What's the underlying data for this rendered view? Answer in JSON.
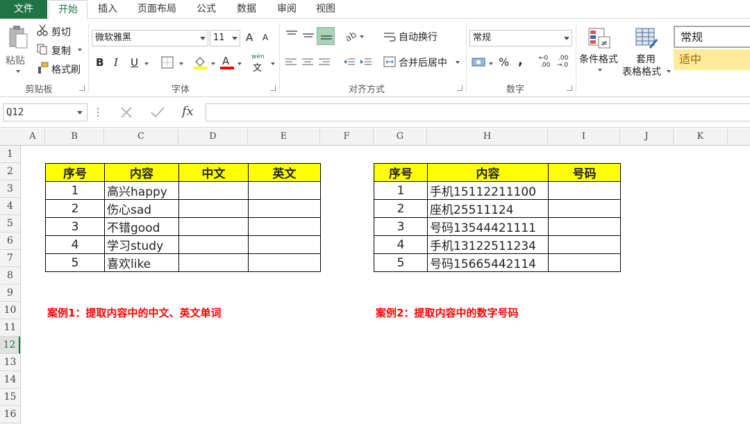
{
  "tabs": [
    "文件",
    "开始",
    "插入",
    "页面布局",
    "公式",
    "数据",
    "审阅",
    "视图"
  ],
  "clipboard": {
    "paste": "粘贴",
    "cut": "剪切",
    "copy": "复制",
    "format_painter": "格式刷",
    "title": "剪贴板"
  },
  "font": {
    "name": "微软雅黑",
    "size": "11",
    "bold": "B",
    "italic": "I",
    "underline": "U",
    "increase": "A",
    "decrease": "A",
    "wen_top": "wén",
    "wen_bottom": "文",
    "title": "字体"
  },
  "alignment": {
    "wrap": "自动换行",
    "merge": "合并后居中",
    "title": "对齐方式"
  },
  "number": {
    "format": "常规",
    "percent": "%",
    "comma": ",",
    "inc_top": "←0",
    "inc_bottom": ".00",
    "dec_top": ".00",
    "dec_bottom": "→.0",
    "title": "数字"
  },
  "styles": {
    "conditional": "条件格式",
    "table_top": "套用",
    "table_bottom": "表格格式",
    "normal": "常规",
    "neutral": "适中"
  },
  "formula_bar": {
    "name_box": "Q12",
    "fx": "fx"
  },
  "columns": [
    "A",
    "B",
    "C",
    "D",
    "E",
    "F",
    "G",
    "H",
    "I",
    "J",
    "K"
  ],
  "rows": [
    "1",
    "2",
    "3",
    "4",
    "5",
    "6",
    "7",
    "8",
    "9",
    "10",
    "11",
    "12",
    "13",
    "14",
    "15",
    "16"
  ],
  "selected_row": "12",
  "table1": {
    "headers": [
      "序号",
      "内容",
      "中文",
      "英文"
    ],
    "rows": [
      [
        "1",
        "高兴happy",
        "",
        ""
      ],
      [
        "2",
        "伤心sad",
        "",
        ""
      ],
      [
        "3",
        "不错good",
        "",
        ""
      ],
      [
        "4",
        "学习study",
        "",
        ""
      ],
      [
        "5",
        "喜欢like",
        "",
        ""
      ]
    ]
  },
  "table2": {
    "headers": [
      "序号",
      "内容",
      "号码"
    ],
    "rows": [
      [
        "1",
        "手机15112211100",
        ""
      ],
      [
        "2",
        "座机25511124",
        ""
      ],
      [
        "3",
        "号码13544421111",
        ""
      ],
      [
        "4",
        "手机13122511234",
        ""
      ],
      [
        "5",
        "号码15665442114",
        ""
      ]
    ]
  },
  "captions": {
    "case1": "案例1：提取内容中的中文、英文单词",
    "case2": "案例2：提取内容中的数字号码"
  },
  "colors": {
    "excel_green": "#217346",
    "header_fill": "#ffff00",
    "caption_red": "#ff0000",
    "neutral_fill": "#ffeb9c",
    "neutral_text": "#9c6500"
  }
}
